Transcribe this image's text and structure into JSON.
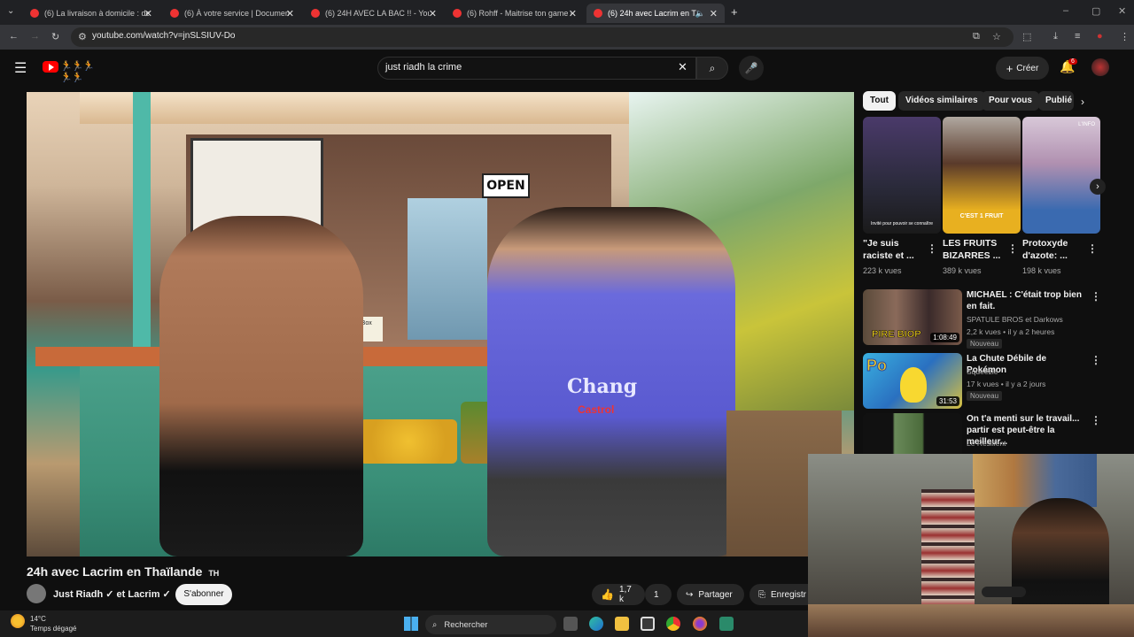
{
  "browser": {
    "tabs": [
      {
        "title": "(6) La livraison à domicile : de l"
      },
      {
        "title": "(6) À votre service | Documenta"
      },
      {
        "title": "(6) 24H AVEC LA BAC !! - YouTu"
      },
      {
        "title": "(6) Rohff - Maitrise ton game (L"
      },
      {
        "title": "(6) 24h avec Lacrim en Thaïl"
      }
    ],
    "url": "youtube.com/watch?v=jnSLSIUV-Do"
  },
  "youtube": {
    "search_query": "just riadh la crime",
    "create_label": "Créer",
    "notification_count": "6"
  },
  "video": {
    "title": "24h avec Lacrim en Thaïlande",
    "title_suffix": "TH",
    "channel": "Just Riadh ✓ et Lacrim ✓",
    "subscribe_label": "S'abonner",
    "like_count": "1,7 k",
    "second_count": "1",
    "share_label": "Partager",
    "save_label": "Enregistr",
    "sign_open": "OPEN",
    "sign_tipbox": "Tip Box",
    "jersey_text": "Chang",
    "jersey_text2": "Castrol"
  },
  "sidebar": {
    "chips": [
      "Tout",
      "Vidéos similaires",
      "Pour vous",
      "Publié"
    ],
    "shorts": [
      {
        "title": "\"Je suis raciste et ...",
        "views": "223 k vues",
        "caption": "Invité pour pouvoir se connaître"
      },
      {
        "title": "LES FRUITS BIZARRES ...",
        "views": "389 k vues",
        "caption": "C'EST 1 FRUIT"
      },
      {
        "title": "Protoxyde d'azote: ...",
        "views": "198 k vues",
        "caption": "L'INFO"
      }
    ],
    "videos": [
      {
        "title": "MICHAEL : C'était trop bien en fait.",
        "channel": "SPATULE BROS et Darkows",
        "meta": "2,2 k vues • il y a 2 heures",
        "badge": "Nouveau",
        "duration": "1:08:49",
        "thumb_text": "PIRE BIOP"
      },
      {
        "title": "La Chute Débile de Pokémon",
        "channel": "Squeezie",
        "meta": "17 k vues • il y a 2 jours",
        "badge": "Nouveau",
        "duration": "31:53",
        "thumb_text": "Po"
      },
      {
        "title": "On t'a menti sur le travail... partir est peut-être la meilleur...",
        "channel": "Le Résilient",
        "meta": "",
        "badge": "",
        "duration": "",
        "thumb_text": ""
      }
    ]
  },
  "taskbar": {
    "temperature": "14°C",
    "weather": "Temps dégagé",
    "search_label": "Rechercher"
  },
  "colors": {
    "yt_red": "#ff0000",
    "background": "#0f0f0f",
    "chip_active": "#f1f1f1"
  }
}
